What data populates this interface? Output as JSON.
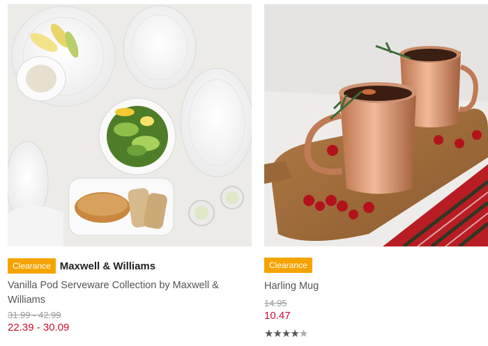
{
  "products": [
    {
      "badge": "Clearance",
      "brand": "Maxwell & Williams",
      "title": "Vanilla Pod Serveware Collection by Maxwell & Williams",
      "old_price": "31.99 - 42.99",
      "new_price": "22.39 - 30.09",
      "image_icon": "tableware-photo"
    },
    {
      "badge": "Clearance",
      "title": "Harling Mug",
      "old_price": "14.95",
      "new_price": "10.47",
      "rating": 4.5,
      "rating_max": 5,
      "image_icon": "copper-mug-photo"
    }
  ],
  "colors": {
    "badge": "#f5a300",
    "sale_price": "#c8102e",
    "old_price": "#9a9a9a"
  }
}
